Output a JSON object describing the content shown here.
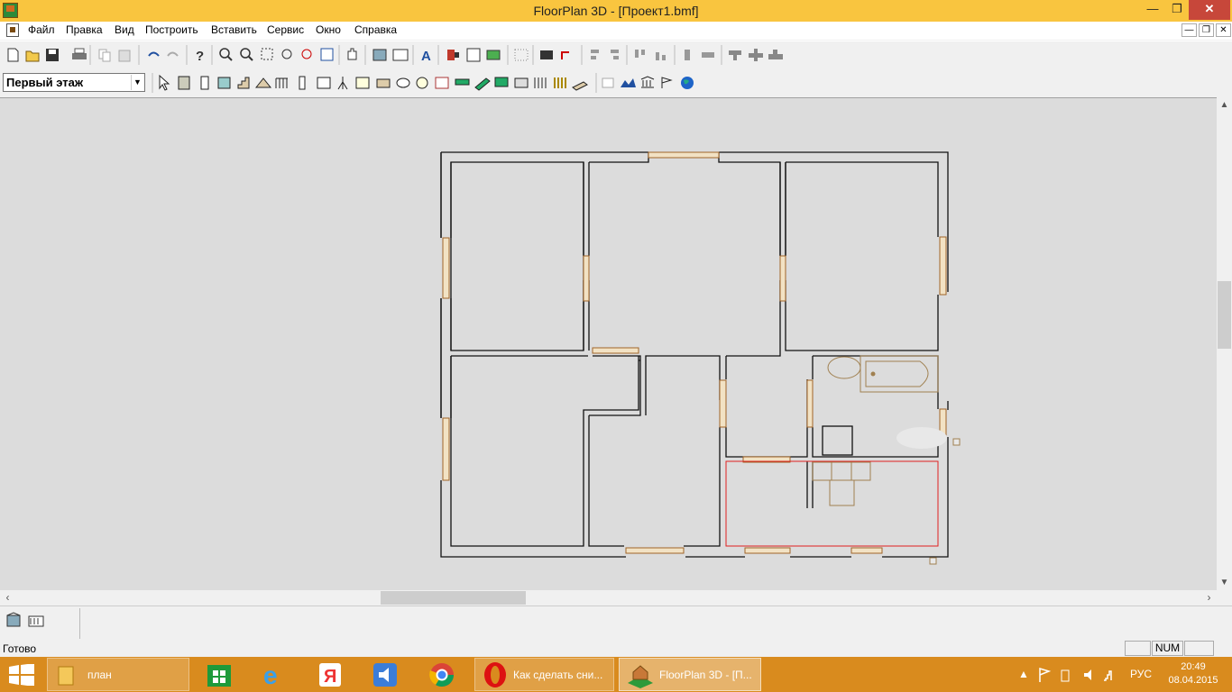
{
  "window": {
    "title": "FloorPlan 3D - [Проект1.bmf]",
    "minimize": "—",
    "maximize": "❐",
    "close": "✕"
  },
  "menu": {
    "items": [
      {
        "label": "Файл"
      },
      {
        "label": "Правка"
      },
      {
        "label": "Вид"
      },
      {
        "label": "Построить"
      },
      {
        "label": "Вставить"
      },
      {
        "label": "Сервис"
      },
      {
        "label": "Окно"
      },
      {
        "label": "Справка"
      }
    ],
    "mdi": {
      "minimize": "—",
      "restore": "❐",
      "close": "✕"
    }
  },
  "toolbar_main": {
    "icons": [
      "new-file-icon",
      "open-folder-icon",
      "save-icon",
      "print-icon",
      "copy-icon",
      "paste-icon",
      "undo-icon",
      "redo-icon",
      "help-icon",
      "zoom-in-icon",
      "zoom-out-icon",
      "zoom-window-icon",
      "zoom-fit-icon",
      "zoom-previous-icon",
      "zoom-all-icon",
      "pan-hand-icon",
      "view-3d-icon",
      "view-2d-icon",
      "text-tool-icon",
      "paint-icon",
      "materials-icon",
      "landscape-icon",
      "grid-icon",
      "render-icon",
      "refresh-icon",
      "align-left-icon",
      "align-right-icon",
      "align-top-icon",
      "align-bottom-icon",
      "center-vertical-icon",
      "center-horizontal-icon",
      "distribute-horizontal-icon",
      "distribute-center-icon",
      "distribute-vertical-icon"
    ]
  },
  "toolbar_draw": {
    "floor_select": {
      "value": "Первый этаж",
      "arrow": "▼"
    },
    "icons": [
      "select-arrow-icon",
      "wall-icon",
      "door-icon",
      "window-icon",
      "stairs-icon",
      "roof-icon",
      "railing-icon",
      "column-icon",
      "survey-point-icon",
      "cabinet-icon",
      "room-icon",
      "furniture-icon",
      "bath-icon",
      "fixture-icon",
      "appliance-icon",
      "fireplace-icon",
      "deck-icon",
      "ramp-icon",
      "electrical-icon",
      "lighting-icon",
      "fence-icon",
      "gate-icon",
      "terrain-path-icon",
      "table-icon",
      "terrain-icon",
      "landmark-icon",
      "flag-icon",
      "globe-icon"
    ]
  },
  "status": {
    "text": "Готово",
    "panes": [
      "",
      "NUM",
      ""
    ]
  },
  "taskbar": {
    "items": [
      {
        "label": "план"
      },
      {
        "label": "Как сделать сни..."
      },
      {
        "label": "FloorPlan 3D - [П..."
      }
    ],
    "language": "РУС",
    "time": "20:49",
    "date": "08.04.2015",
    "icons": [
      "file-explorer-icon",
      "windows-store-icon",
      "internet-explorer-icon",
      "yandex-browser-icon",
      "volume-app-icon",
      "chrome-icon",
      "opera-icon",
      "floorplan-icon"
    ]
  },
  "colors": {
    "titlebar": "#f9c53f",
    "taskbar": "#d98b1e",
    "workspace": "#dcdcdc",
    "selection": "#e02020",
    "fixture_lines": "#a08050",
    "window_frame": "#c87838"
  }
}
